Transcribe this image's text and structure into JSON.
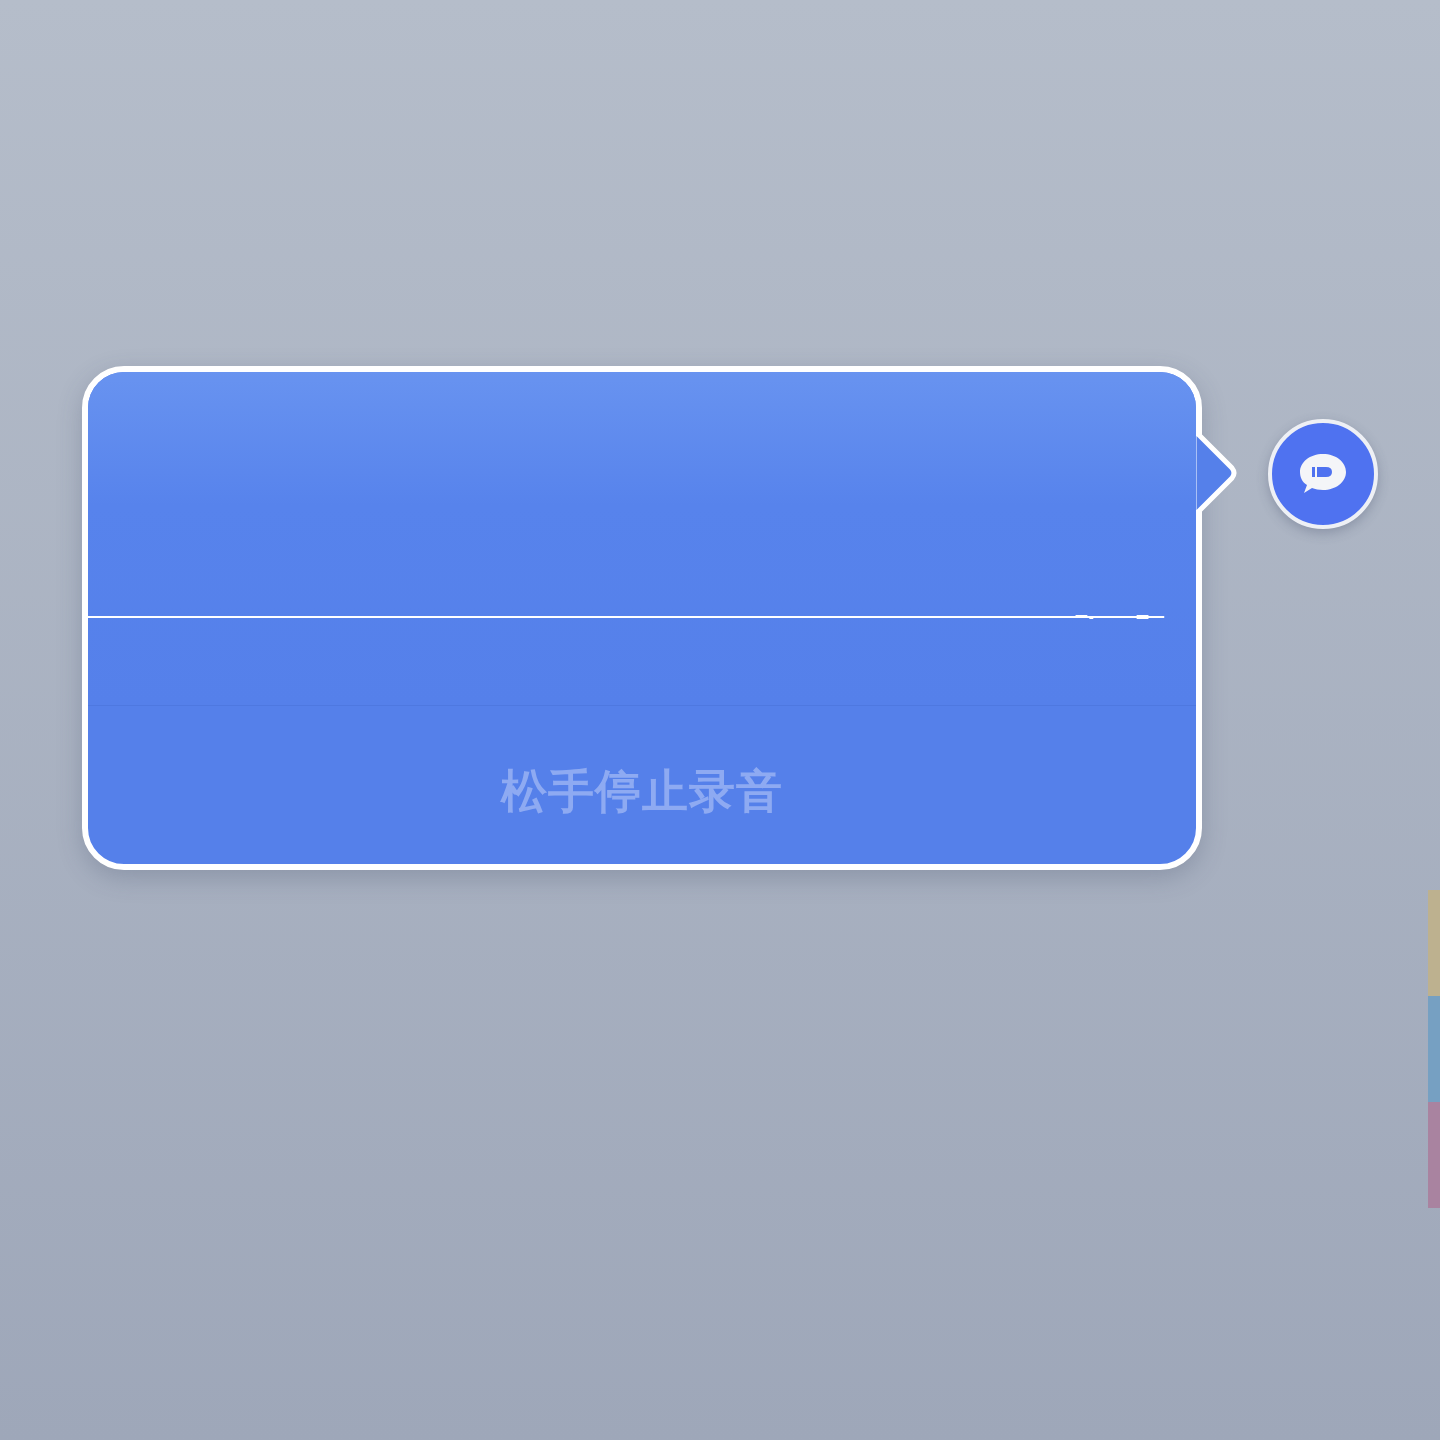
{
  "recording_panel": {
    "hint": "松手停止录音"
  },
  "edge_tabs": [
    {
      "color": "#bdb18f"
    },
    {
      "color": "#76a0c2"
    },
    {
      "color": "#a983a0"
    }
  ]
}
